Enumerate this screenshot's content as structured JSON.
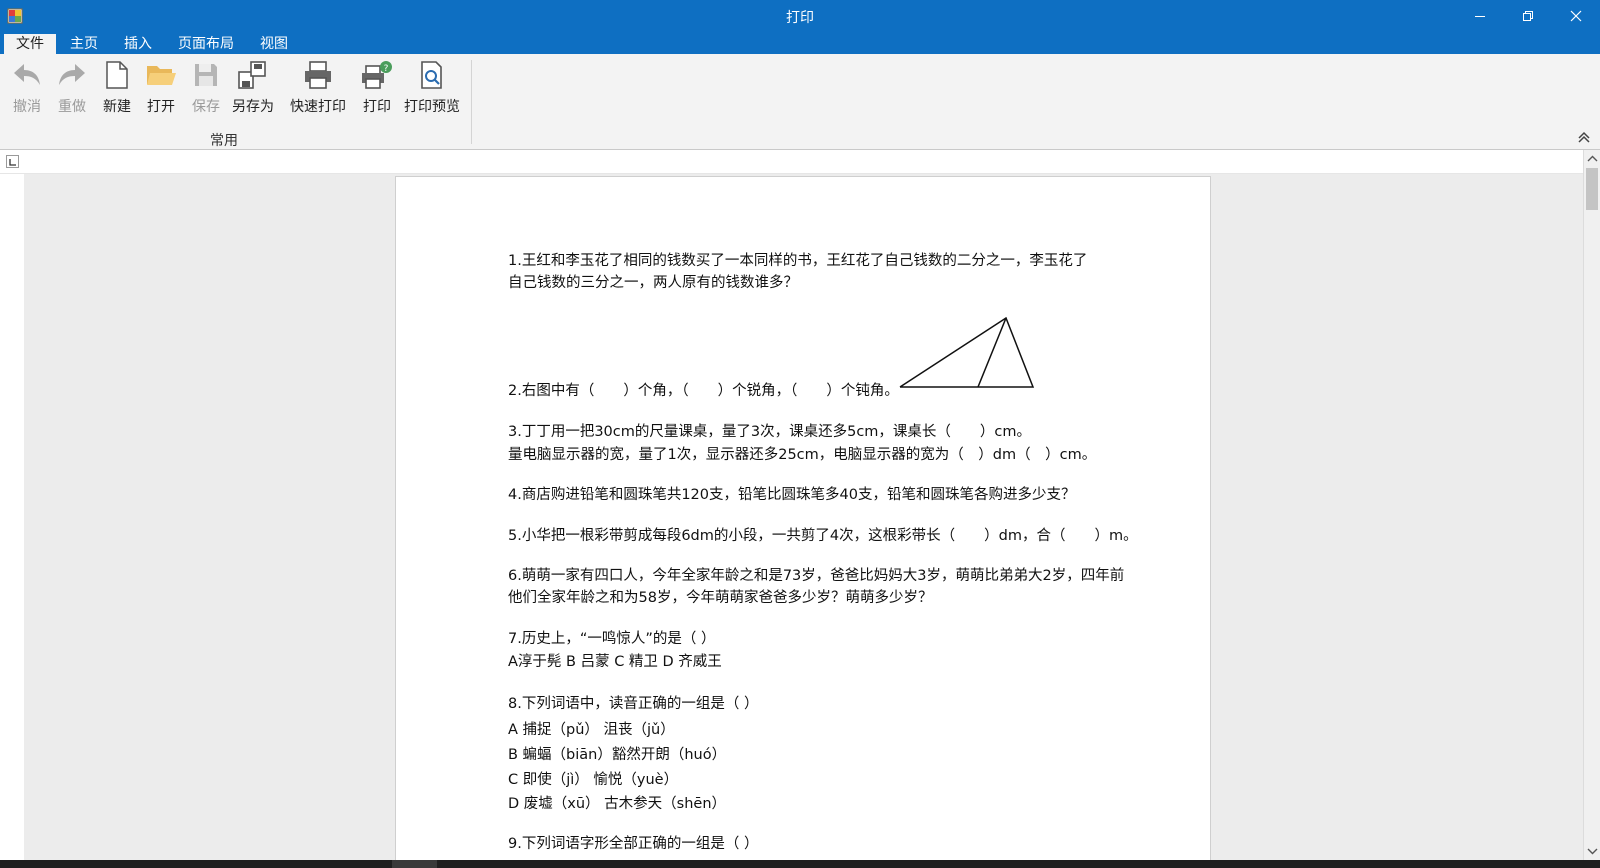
{
  "window": {
    "title": "打印"
  },
  "menu": {
    "tabs": [
      "文件",
      "主页",
      "插入",
      "页面布局",
      "视图"
    ]
  },
  "ribbon": {
    "group_label": "常用",
    "buttons": [
      {
        "label": "撤消",
        "icon": "undo-icon",
        "enabled": false
      },
      {
        "label": "重做",
        "icon": "redo-icon",
        "enabled": false
      },
      {
        "label": "新建",
        "icon": "new-document-icon",
        "enabled": true
      },
      {
        "label": "打开",
        "icon": "open-folder-icon",
        "enabled": true
      },
      {
        "label": "保存",
        "icon": "save-icon",
        "enabled": false
      },
      {
        "label": "另存为",
        "icon": "save-as-icon",
        "enabled": true
      },
      {
        "label": "快速打印",
        "icon": "quick-print-icon",
        "enabled": true
      },
      {
        "label": "打印",
        "icon": "print-icon",
        "enabled": true
      },
      {
        "label": "打印预览",
        "icon": "print-preview-icon",
        "enabled": true
      }
    ]
  },
  "document": {
    "lines": [
      "1.王红和李玉花了相同的钱数买了一本同样的书，王红花了自己钱数的二分之一，李玉花了",
      "自己钱数的三分之一，两人原有的钱数谁多？",
      "2.右图中有（　　）个角，（　　）个锐角，（　　）个钝角。",
      "3.丁丁用一把30cm的尺量课桌，量了3次，课桌还多5cm，课桌长（　　）cm。",
      "量电脑显示器的宽，量了1次，显示器还多25cm，电脑显示器的宽为（　）dm（　）cm。",
      "4.商店购进铅笔和圆珠笔共120支，铅笔比圆珠笔多40支，铅笔和圆珠笔各购进多少支？",
      "5.小华把一根彩带剪成每段6dm的小段，一共剪了4次，这根彩带长（　　）dm，合（　　）m。",
      "6.萌萌一家有四口人，今年全家年龄之和是73岁，爸爸比妈妈大3岁，萌萌比弟弟大2岁，四年前",
      "他们全家年龄之和为58岁，今年萌萌家爸爸多少岁？萌萌多少岁？",
      "7.历史上，“一鸣惊人”的是（ ）",
      "A淳于髡 B 吕蒙 C 精卫 D 齐威王",
      "8.下列词语中，读音正确的一组是（ ）",
      "A 捕捉（pǔ） 沮丧（jǔ）",
      "B 蝙蝠（biān）豁然开朗（huó）",
      "C 即使（jì） 愉悦（yuè）",
      "D 废墟（xū） 古木参天（shēn）",
      "9.下列词语字形全部正确的一组是（ ）"
    ]
  },
  "colors": {
    "titlebar": "#0e6fc2",
    "ribbon_bg": "#f3f3f3",
    "workspace_bg": "#ececec"
  }
}
